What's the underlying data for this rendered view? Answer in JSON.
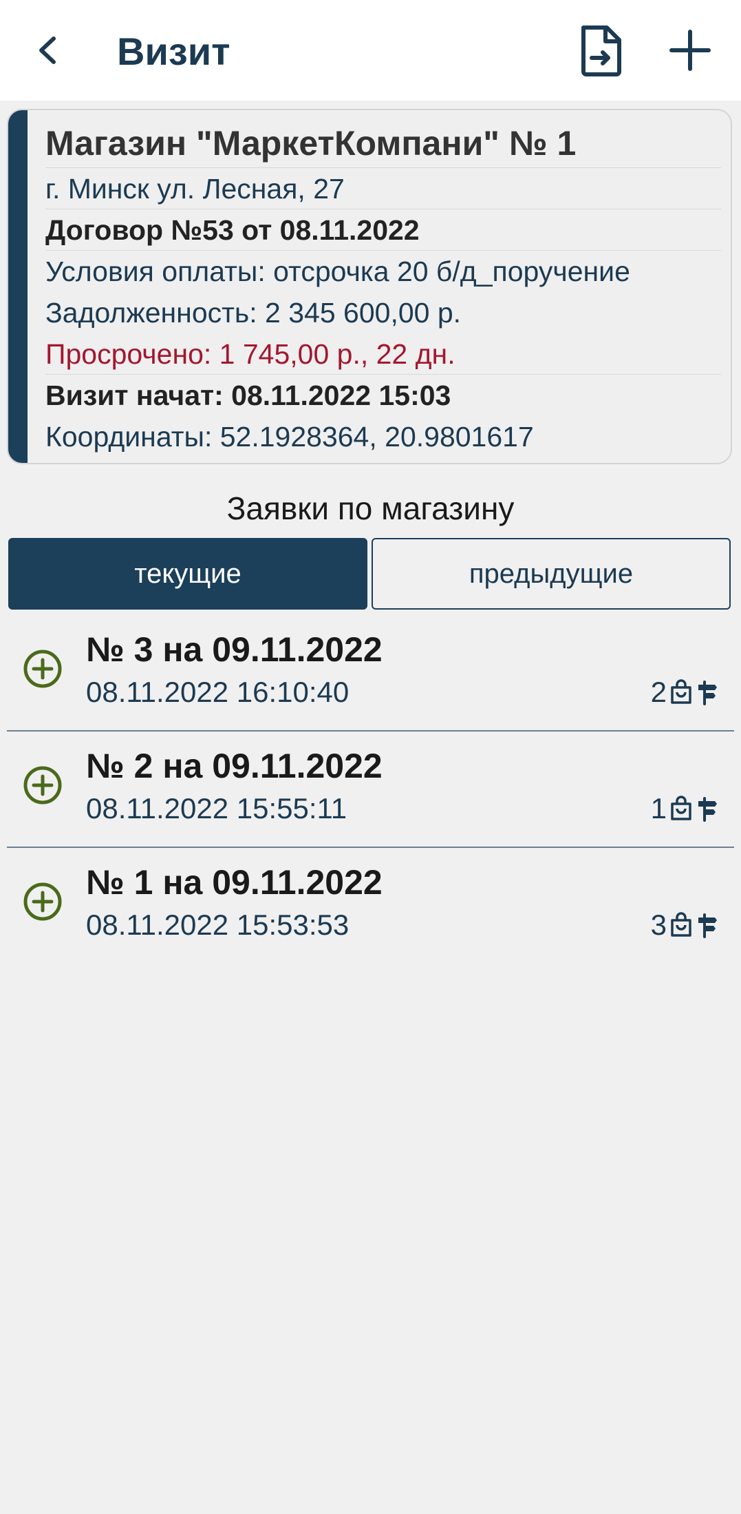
{
  "header": {
    "title": "Визит"
  },
  "store": {
    "name": "Магазин \"МаркетКомпани\" № 1",
    "address": "г. Минск ул. Лесная, 27",
    "contract": "Договор №53 от 08.11.2022",
    "payment_terms": "Условия оплаты: отсрочка 20 б/д_поручение",
    "debt": "Задолженность: 2 345 600,00 р.",
    "overdue": "Просрочено: 1 745,00 р., 22 дн.",
    "visit_started": "Визит начат: 08.11.2022 15:03",
    "coordinates": "Координаты: 52.1928364, 20.9801617"
  },
  "colors": {
    "primary": "#1c3f5a",
    "overdue": "#a3172f",
    "add_icon": "#4a6a1a"
  },
  "section": {
    "title": "Заявки по магазину"
  },
  "tabs": {
    "current": "текущие",
    "previous": "предыдущие"
  },
  "orders": [
    {
      "title": "№ 3 на 09.11.2022",
      "datetime": "08.11.2022 16:10:40",
      "count": "2"
    },
    {
      "title": "№ 2 на 09.11.2022",
      "datetime": "08.11.2022 15:55:11",
      "count": "1"
    },
    {
      "title": "№ 1 на 09.11.2022",
      "datetime": "08.11.2022 15:53:53",
      "count": "3"
    }
  ],
  "icons": {
    "back": "chevron-left-icon",
    "export": "file-export-icon",
    "add": "plus-icon",
    "order_add": "plus-circle-icon",
    "bag": "shopping-bag-icon",
    "signpost": "signpost-icon"
  }
}
